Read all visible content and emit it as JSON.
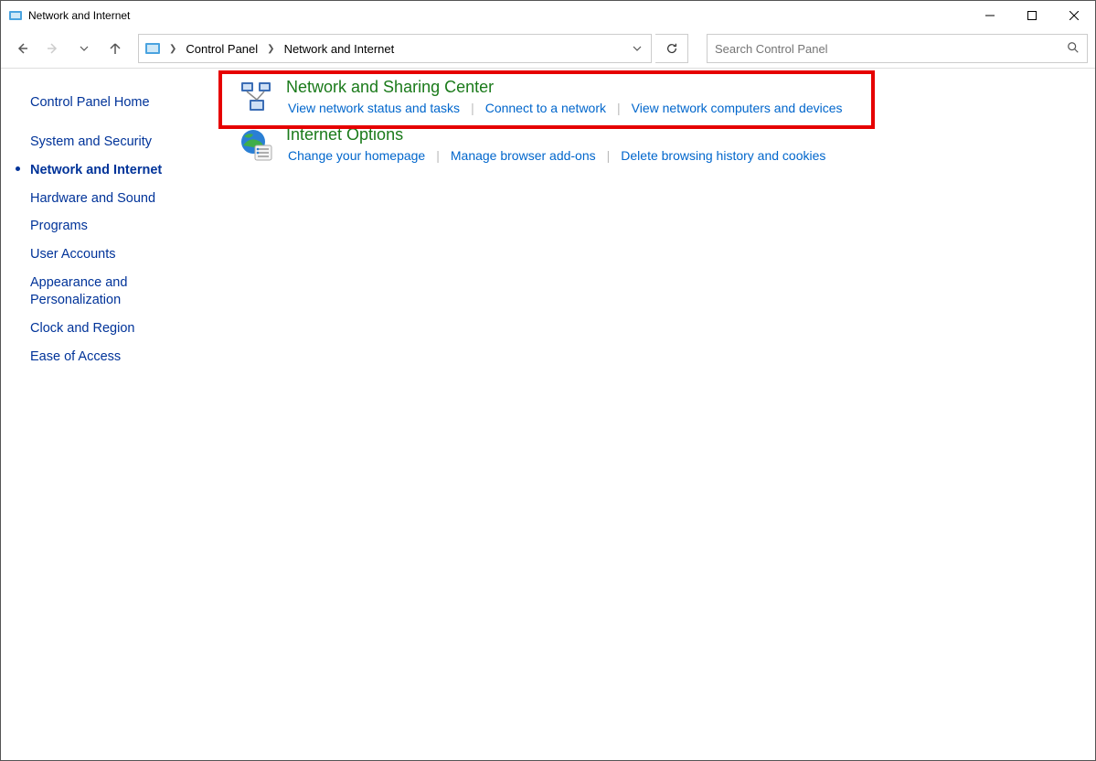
{
  "window": {
    "title": "Network and Internet"
  },
  "breadcrumbs": {
    "level1": "Control Panel",
    "level2": "Network and Internet"
  },
  "search": {
    "placeholder": "Search Control Panel"
  },
  "sidebar": {
    "items": [
      {
        "label": "Control Panel Home",
        "active": false
      },
      {
        "label": "System and Security",
        "active": false
      },
      {
        "label": "Network and Internet",
        "active": true
      },
      {
        "label": "Hardware and Sound",
        "active": false
      },
      {
        "label": "Programs",
        "active": false
      },
      {
        "label": "User Accounts",
        "active": false
      },
      {
        "label": "Appearance and Personalization",
        "active": false
      },
      {
        "label": "Clock and Region",
        "active": false
      },
      {
        "label": "Ease of Access",
        "active": false
      }
    ]
  },
  "sections": [
    {
      "title": "Network and Sharing Center",
      "links": [
        "View network status and tasks",
        "Connect to a network",
        "View network computers and devices"
      ],
      "highlighted": true
    },
    {
      "title": "Internet Options",
      "links": [
        "Change your homepage",
        "Manage browser add-ons",
        "Delete browsing history and cookies"
      ],
      "highlighted": false
    }
  ]
}
